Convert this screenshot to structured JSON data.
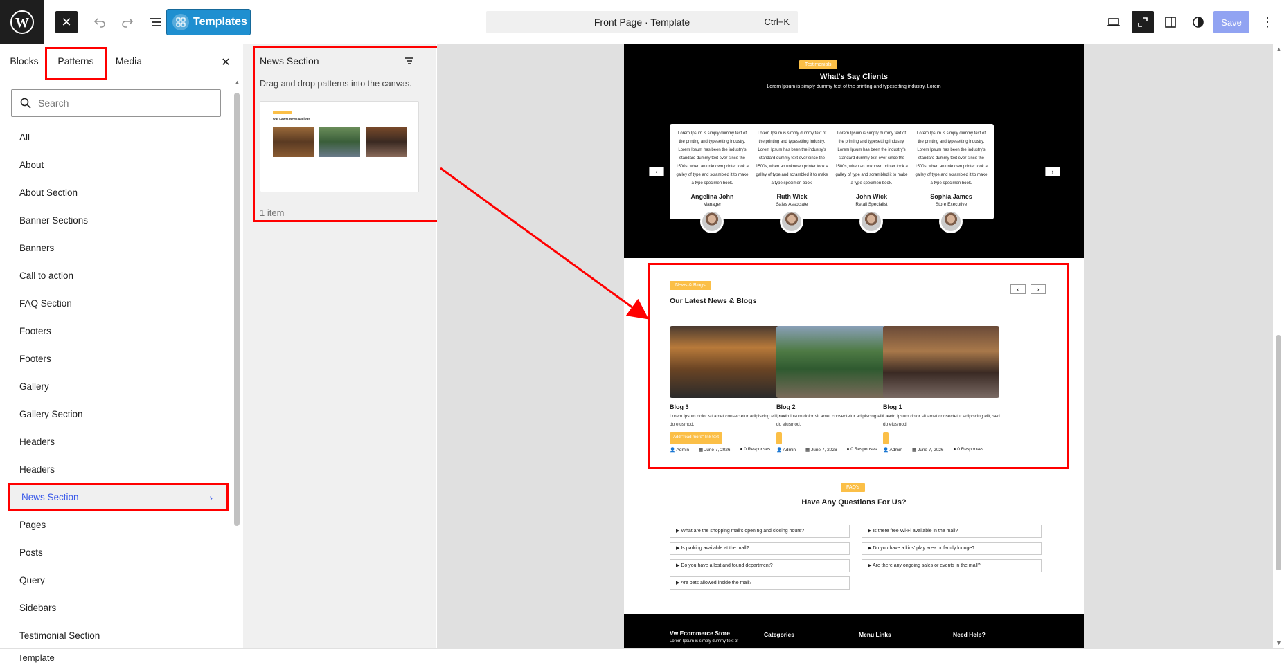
{
  "toolbar": {
    "templates_label": "Templates",
    "command": {
      "title": "Front Page · Template",
      "shortcut": "Ctrl+K"
    },
    "save_label": "Save"
  },
  "inserter": {
    "tabs": [
      "Blocks",
      "Patterns",
      "Media"
    ],
    "active_tab": "Patterns",
    "search_placeholder": "Search",
    "categories": [
      "All",
      "About",
      "About Section",
      "Banner Sections",
      "Banners",
      "Call to action",
      "FAQ Section",
      "Footers",
      "Footers",
      "Gallery",
      "Gallery Section",
      "Headers",
      "Headers",
      "News Section",
      "Pages",
      "Posts",
      "Query",
      "Sidebars",
      "Testimonial Section"
    ],
    "active_category": "News Section"
  },
  "pattern_panel": {
    "title": "News Section",
    "description": "Drag and drop patterns into the canvas.",
    "count": "1 item",
    "preview": {
      "tag": "News & Blogs",
      "heading": "Our Latest News & Blogs"
    }
  },
  "canvas": {
    "testimonials": {
      "tag": "Testimonials",
      "heading": "What's Say Clients",
      "subtitle": "Lorem Ipsum is simply dummy text of the printing and typesetting industry. Lorem",
      "quote": "Lorem Ipsum is simply dummy text of the printing and typesetting industry. Lorem Ipsum has been the industry's standard dummy text ever since the 1500s, when an unknown printer took a galley of type and scrambled it to make a type specimen book.",
      "cards": [
        {
          "name": "Angelina John",
          "role": "Manager"
        },
        {
          "name": "Ruth Wick",
          "role": "Sales Associate"
        },
        {
          "name": "John Wick",
          "role": "Retail Specialist"
        },
        {
          "name": "Sophia James",
          "role": "Store Executive"
        }
      ]
    },
    "news": {
      "tag": "News & Blogs",
      "heading": "Our Latest News & Blogs",
      "excerpt": "Lorem ipsum dolor sit amet consectetur adipiscing elit, sed do eiusmod.",
      "read_more": "Add \"read more\" link text",
      "blogs": [
        {
          "title": "Blog 3",
          "author": "Admin",
          "date": "June 7, 2026",
          "responses": "0 Responses"
        },
        {
          "title": "Blog 2",
          "author": "Admin",
          "date": "June 7, 2026",
          "responses": "0 Responses"
        },
        {
          "title": "Blog 1",
          "author": "Admin",
          "date": "June 7, 2026",
          "responses": "0 Responses"
        }
      ]
    },
    "faq": {
      "tag": "FAQ's",
      "heading": "Have Any Questions For Us?",
      "left": [
        "What are the shopping mall's opening and closing hours?",
        "Is parking available at the mall?",
        "Do you have a lost and found department?",
        "Are pets allowed inside the mall?"
      ],
      "right": [
        "Is there free Wi-Fi available in the mall?",
        "Do you have a kids' play area or family lounge?",
        "Are there any ongoing sales or events in the mall?"
      ]
    },
    "footer": {
      "brand": "Vw Ecommerce Store",
      "brand_text": "Lorem Ipsum is simply dummy text of",
      "col1": "Categories",
      "col2": "Menu Links",
      "col3": "Need Help?"
    }
  },
  "status_bar": {
    "label": "Template"
  },
  "colors": {
    "accent": "#3858e9",
    "highlight": "#ff0000",
    "tag": "#fbbf47",
    "templates_button": "#1f8fd0"
  }
}
